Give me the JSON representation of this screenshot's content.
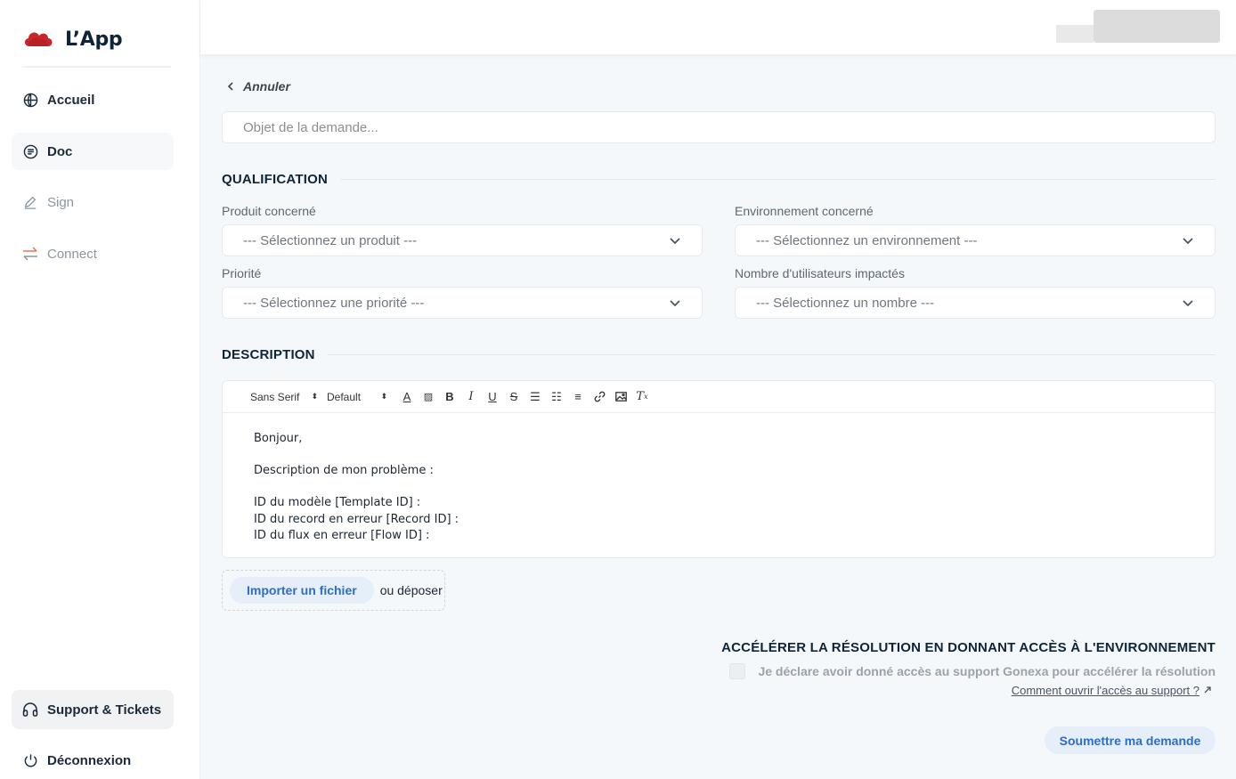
{
  "app": {
    "name": "L’App",
    "brand_color": "#c8262b"
  },
  "sidebar": {
    "items": [
      {
        "label": "Accueil",
        "icon": "globe-icon"
      },
      {
        "label": "Doc",
        "icon": "doc-circle-icon"
      },
      {
        "label": "Sign",
        "icon": "pen-icon"
      },
      {
        "label": "Connect",
        "icon": "arrows-exchange-icon"
      }
    ],
    "bottom": [
      {
        "label": "Support & Tickets",
        "icon": "headset-icon"
      },
      {
        "label": "Déconnexion",
        "icon": "power-icon"
      }
    ]
  },
  "form": {
    "back_label": "Annuler",
    "subject_placeholder": "Objet de la demande...",
    "qualification_title": "QUALIFICATION",
    "fields": {
      "product": {
        "label": "Produit concerné",
        "value": "--- Sélectionnez un produit ---"
      },
      "environment": {
        "label": "Environnement concerné",
        "value": "--- Sélectionnez un environnement ---"
      },
      "priority": {
        "label": "Priorité",
        "value": "--- Sélectionnez une priorité ---"
      },
      "users": {
        "label": "Nombre d'utilisateurs impactés",
        "value": "--- Sélectionnez un nombre ---"
      }
    },
    "description_title": "DESCRIPTION",
    "editor": {
      "font": "Sans Serif",
      "size": "Default",
      "lines": [
        "Bonjour,",
        "",
        "Description de mon problème :",
        "",
        "ID du modèle [Template ID] :",
        "ID du record en erreur [Record ID] :",
        "ID du flux en erreur [Flow ID] :"
      ]
    },
    "import_label": "Importer un fichier",
    "drop_label": "ou déposer",
    "access_title": "ACCÉLÉRER LA RÉSOLUTION EN DONNANT ACCÈS À L'ENVIRONNEMENT",
    "access_checkbox_label": "Je déclare avoir donné accès au support Gonexa pour accélérer la résolution",
    "access_checked": false,
    "access_link": "Comment ouvrir l'accès au support ?",
    "submit_label": "Soumettre ma demande"
  }
}
